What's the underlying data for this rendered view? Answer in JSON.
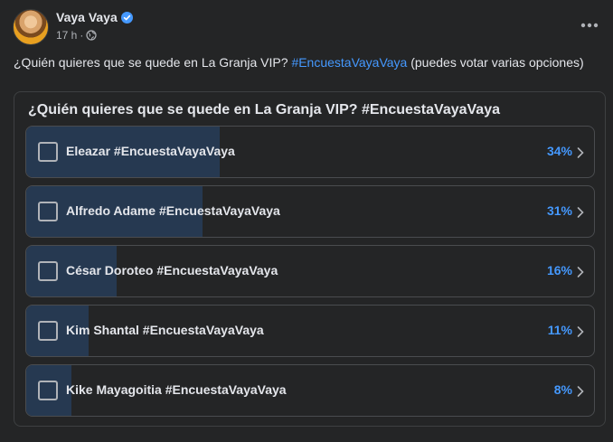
{
  "post": {
    "author": "Vaya Vaya",
    "time": "17 h",
    "separator": "·",
    "text_prefix": "¿Quién quieres que se quede en La Granja VIP?",
    "text_hashtag": "#EncuestaVayaVaya",
    "text_suffix": "(puedes votar varias opciones)"
  },
  "poll": {
    "title": "¿Quién quieres que se quede en La Granja VIP? #EncuestaVayaVaya",
    "options": [
      {
        "label": "Eleazar #EncuestaVayaVaya",
        "percent_text": "34%",
        "percent": 34
      },
      {
        "label": "Alfredo Adame #EncuestaVayaVaya",
        "percent_text": "31%",
        "percent": 31
      },
      {
        "label": "César Doroteo #EncuestaVayaVaya",
        "percent_text": "16%",
        "percent": 16
      },
      {
        "label": "Kim Shantal #EncuestaVayaVaya",
        "percent_text": "11%",
        "percent": 11
      },
      {
        "label": "Kike Mayagoitia #EncuestaVayaVaya",
        "percent_text": "8%",
        "percent": 8
      }
    ]
  },
  "icons": {
    "verified": "verified-badge-icon",
    "audience": "globe-icon",
    "more": "more-horizontal-icon",
    "chevron": "chevron-right-icon"
  },
  "colors": {
    "background": "#242526",
    "accent": "#4599ff",
    "fill": "#263951"
  }
}
